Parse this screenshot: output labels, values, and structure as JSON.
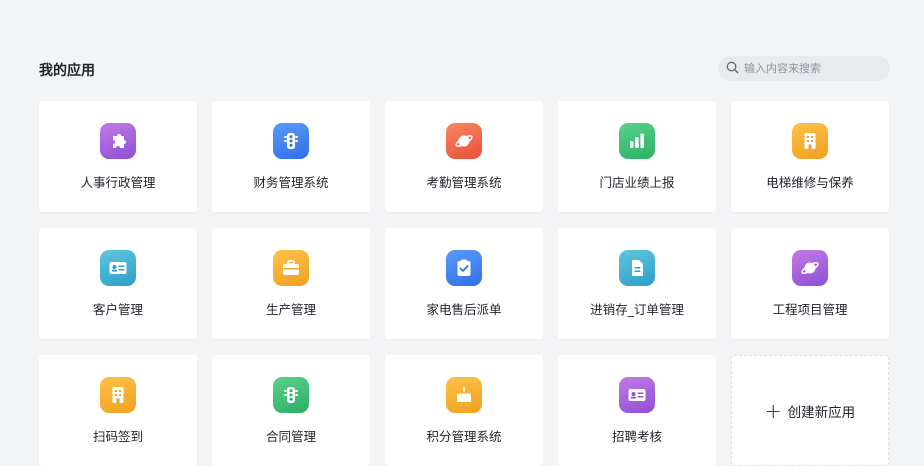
{
  "header": {
    "title": "我的应用",
    "search_placeholder": "输入内容来搜索"
  },
  "apps": [
    {
      "label": "人事行政管理",
      "icon": "puzzle-icon",
      "colors": [
        "#c27ae6",
        "#8f4fd6"
      ]
    },
    {
      "label": "财务管理系统",
      "icon": "traffic-light-icon",
      "colors": [
        "#5b9bf8",
        "#2f6fe8"
      ]
    },
    {
      "label": "考勤管理系统",
      "icon": "planet-icon",
      "colors": [
        "#f98762",
        "#e8503a"
      ]
    },
    {
      "label": "门店业绩上报",
      "icon": "bar-chart-icon",
      "colors": [
        "#5ad18a",
        "#2bb065"
      ]
    },
    {
      "label": "电梯维修与保养",
      "icon": "building-icon",
      "colors": [
        "#fcc24a",
        "#f0a020"
      ]
    },
    {
      "label": "客户管理",
      "icon": "id-card-icon",
      "colors": [
        "#5ec5dd",
        "#2e9ec8"
      ]
    },
    {
      "label": "生产管理",
      "icon": "briefcase-icon",
      "colors": [
        "#fcc24a",
        "#f0a020"
      ]
    },
    {
      "label": "家电售后派单",
      "icon": "clipboard-check-icon",
      "colors": [
        "#5b9bf8",
        "#2f6fe8"
      ]
    },
    {
      "label": "进销存_订单管理",
      "icon": "document-icon",
      "colors": [
        "#5ec5dd",
        "#2e9ec8"
      ]
    },
    {
      "label": "工程项目管理",
      "icon": "planet-icon",
      "colors": [
        "#c27ae6",
        "#8f4fd6"
      ]
    },
    {
      "label": "扫码签到",
      "icon": "building-icon",
      "colors": [
        "#fcc24a",
        "#f0a020"
      ]
    },
    {
      "label": "合同管理",
      "icon": "traffic-light-icon",
      "colors": [
        "#5ad18a",
        "#2bb065"
      ]
    },
    {
      "label": "积分管理系统",
      "icon": "cake-icon",
      "colors": [
        "#fcc24a",
        "#f0a020"
      ]
    },
    {
      "label": "招聘考核",
      "icon": "id-card-icon",
      "colors": [
        "#c27ae6",
        "#8f4fd6"
      ]
    }
  ],
  "add_app": {
    "plus": "+",
    "label": "创建新应用"
  }
}
